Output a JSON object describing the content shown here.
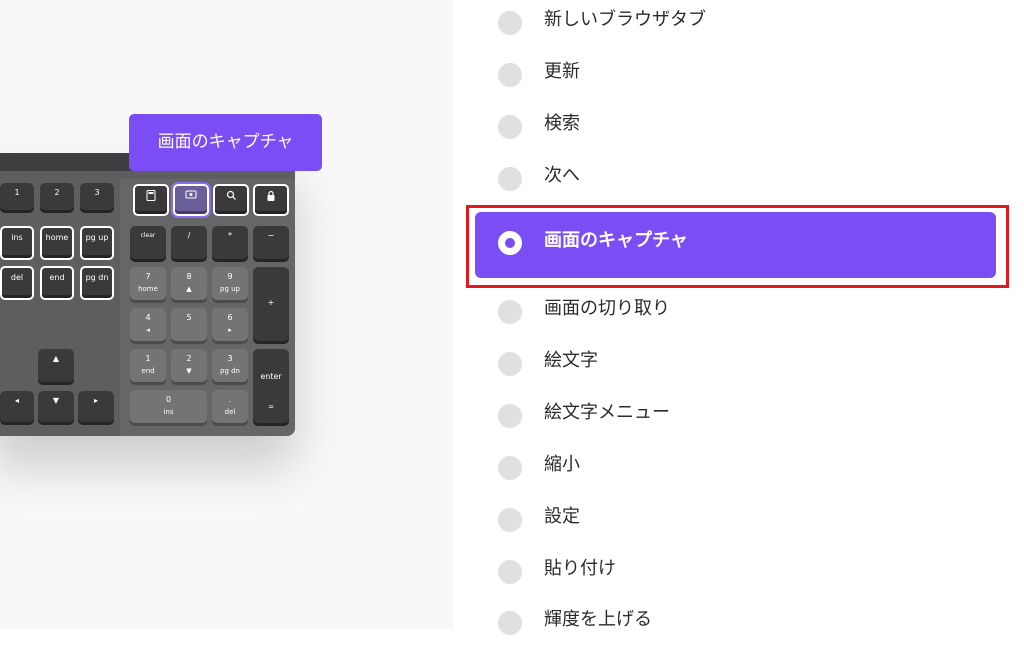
{
  "preview": {
    "tooltip": "画面のキャプチャ",
    "keys": {
      "f_row": [
        "1",
        "2",
        "3"
      ],
      "nav_row1": [
        "ins",
        "home",
        "pg up"
      ],
      "nav_row2": [
        "del",
        "end",
        "pg dn"
      ],
      "clear": "clear",
      "slash": "/",
      "star": "*",
      "minus": "−",
      "plus": "+",
      "enter": "enter",
      "enter_sub": "=",
      "n7": "7",
      "n7_sub": "home",
      "n8": "8",
      "n8_sub": "▲",
      "n9": "9",
      "n9_sub": "pg up",
      "n4": "4",
      "n4_sub": "◂",
      "n5": "5",
      "n5_sub": "",
      "n6": "6",
      "n6_sub": "▸",
      "n1": "1",
      "n1_sub": "end",
      "n2": "2",
      "n2_sub": "▼",
      "n3": "3",
      "n3_sub": "pg dn",
      "n0": "0",
      "n0_sub": "ins",
      "dot": ".",
      "dot_sub": "del",
      "arrow_up": "▲",
      "arrow_left": "◂",
      "arrow_down": "▼",
      "arrow_right": "▸"
    },
    "icons": {
      "calculator": "calculator-icon",
      "screenshot": "screenshot-icon",
      "search": "search-icon",
      "lock": "lock-icon"
    }
  },
  "actions": {
    "items": [
      {
        "label": "新しいブラウザタブ"
      },
      {
        "label": "更新"
      },
      {
        "label": "検索"
      },
      {
        "label": "次へ"
      },
      {
        "label": "画面のキャプチャ"
      },
      {
        "label": "画面の切り取り"
      },
      {
        "label": "絵文字"
      },
      {
        "label": "絵文字メニュー"
      },
      {
        "label": "縮小"
      },
      {
        "label": "設定"
      },
      {
        "label": "貼り付け"
      },
      {
        "label": "輝度を上げる"
      }
    ],
    "selected_index": 4
  },
  "colors": {
    "accent": "#7b4df4",
    "highlight_frame": "#e0191c",
    "radio_off": "#e0e0e2",
    "keyboard_body": "#5e5e60"
  }
}
